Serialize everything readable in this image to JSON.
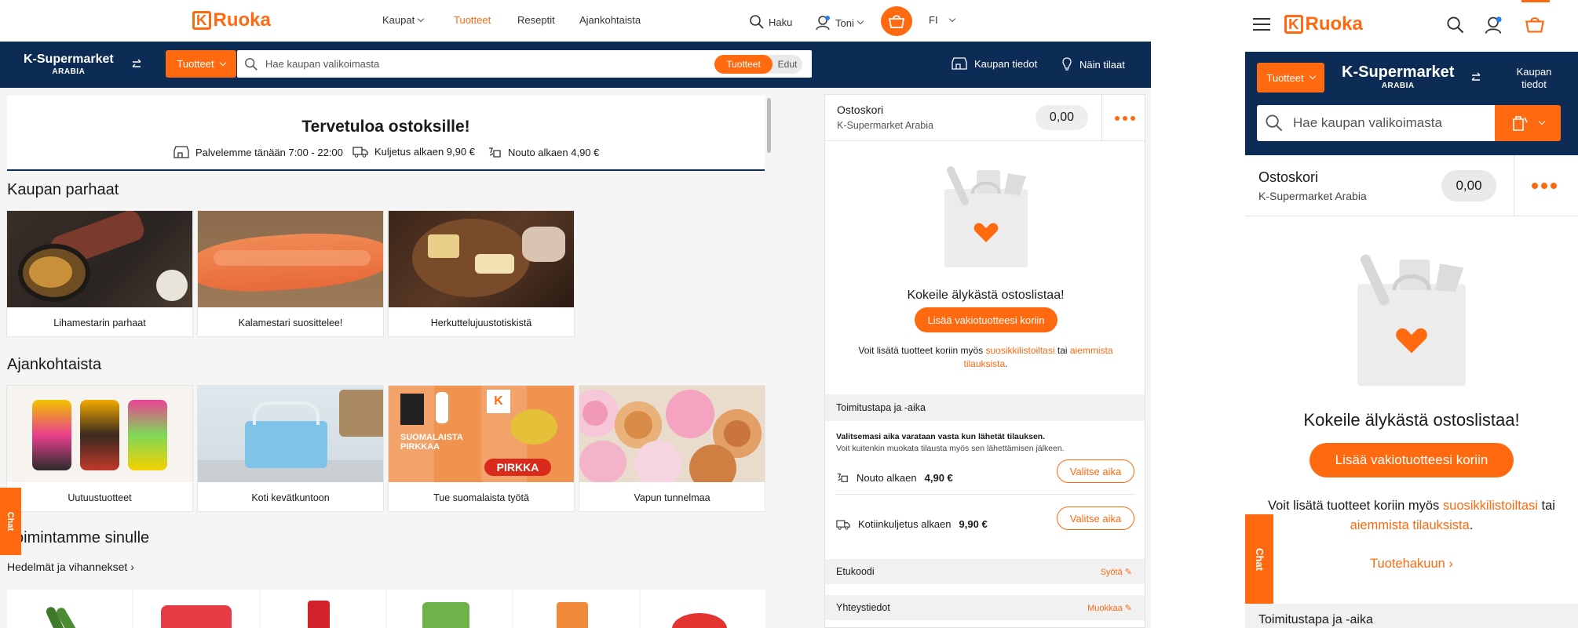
{
  "brand": "Ruoka",
  "nav": {
    "items": [
      "Kaupat",
      "Tuotteet",
      "Reseptit",
      "Ajankohtaista"
    ],
    "search": "Haku",
    "user": "Toni",
    "lang": "FI"
  },
  "store": {
    "name": "K-Supermarket",
    "sub": "ARABIA",
    "products_btn": "Tuotteet",
    "placeholder": "Hae kaupan valikoimasta",
    "toggle": [
      "Tuotteet",
      "Edut"
    ],
    "info": "Kaupan tiedot",
    "howto": "Näin tilaat"
  },
  "welcome": {
    "title": "Tervetuloa ostoksille!",
    "hours": "Palvelemme tänään 7:00 - 22:00",
    "delivery": "Kuljetus alkaen 9,90 €",
    "pickup": "Nouto alkaen 4,90 €"
  },
  "sections": {
    "best": {
      "title": "Kaupan parhaat",
      "cards": [
        "Lihamestarin parhaat",
        "Kalamestari suosittelee!",
        "Herkuttelujuustotiskistä"
      ]
    },
    "news": {
      "title": "Ajankohtaista",
      "cards": [
        "Uutuustuotteet",
        "Koti kevätkuntoon",
        "Tue suomalaista työtä",
        "Vapun tunnelmaa"
      ]
    },
    "forYou": {
      "title": "Toimintamme sinulle",
      "sub": "Hedelmät ja vihannekset ›"
    }
  },
  "promo": {
    "pirkka": "PIRKKA",
    "suomalaista": "SUOMALAISTA PIRKKAA"
  },
  "chat": "Chat",
  "cart": {
    "title": "Ostoskori",
    "store": "K-Supermarket Arabia",
    "total": "0,00",
    "smart": "Kokeile älykästä ostoslistaa!",
    "add_btn": "Lisää vakiotuotteesi koriin",
    "note_pre": "Voit lisätä tuotteet koriin myös",
    "fav": "suosikkilistoiltasi",
    "or": "tai",
    "prev": "aiemmista tilauksista",
    "dot": ".",
    "delivery_head": "Toimitustapa ja -aika",
    "reserve1": "Valitsemasi aika varataan vasta kun lähetät tilauksen.",
    "reserve2": "Voit kuitenkin muokata tilausta myös sen lähettämisen jälkeen.",
    "pickup_pre": "Nouto alkaen",
    "pickup_price": "4,90 €",
    "home_pre": "Kotiinkuljetus alkaen",
    "home_price": "9,90 €",
    "choose": "Valitse aika",
    "code": "Etukoodi",
    "code_act": "Syötä",
    "contact": "Yhteystiedot",
    "contact_act": "Muokkaa"
  },
  "mobile": {
    "store_info": "Kaupan tiedot",
    "search_more": "Tuotehakuun ›",
    "delivery_head": "Toimitustapa ja -aika"
  },
  "colors": {
    "orange": "#ff6a10",
    "navy": "#0c2c55"
  }
}
